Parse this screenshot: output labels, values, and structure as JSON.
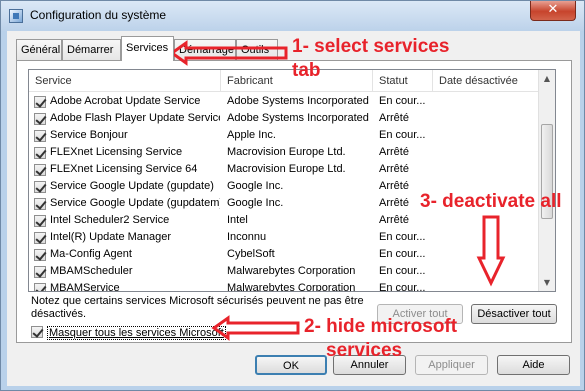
{
  "window": {
    "title": "Configuration du système",
    "close_glyph": "✕"
  },
  "tabs": [
    "Général",
    "Démarrer",
    "Services",
    "Démarrage",
    "Outils"
  ],
  "listview": {
    "columns": [
      "Service",
      "Fabricant",
      "Statut",
      "Date désactivée"
    ],
    "rows": [
      {
        "service": "Adobe Acrobat Update Service",
        "maker": "Adobe Systems Incorporated",
        "status": "En cour..."
      },
      {
        "service": "Adobe Flash Player Update Service",
        "maker": "Adobe Systems Incorporated",
        "status": "Arrêté"
      },
      {
        "service": "Service Bonjour",
        "maker": "Apple Inc.",
        "status": "En cour..."
      },
      {
        "service": "FLEXnet Licensing Service",
        "maker": "Macrovision Europe Ltd.",
        "status": "Arrêté"
      },
      {
        "service": "FLEXnet Licensing Service 64",
        "maker": "Macrovision Europe Ltd.",
        "status": "Arrêté"
      },
      {
        "service": "Service Google Update (gupdate)",
        "maker": "Google Inc.",
        "status": "Arrêté"
      },
      {
        "service": "Service Google Update (gupdatem)",
        "maker": "Google Inc.",
        "status": "Arrêté"
      },
      {
        "service": "Intel Scheduler2 Service",
        "maker": "Intel",
        "status": "Arrêté"
      },
      {
        "service": "Intel(R) Update Manager",
        "maker": "Inconnu",
        "status": "En cour..."
      },
      {
        "service": "Ma-Config Agent",
        "maker": "CybelSoft",
        "status": "En cour..."
      },
      {
        "service": "MBAMScheduler",
        "maker": "Malwarebytes Corporation",
        "status": "En cour..."
      },
      {
        "service": "MBAMService",
        "maker": "Malwarebytes Corporation",
        "status": "En cour..."
      }
    ],
    "scroll_up_glyph": "▲",
    "scroll_down_glyph": "▼"
  },
  "note": "Notez que certains services Microsoft sécurisés peuvent ne pas être désactivés.",
  "buttons": {
    "enable_all": "Activer tout",
    "disable_all": "Désactiver tout",
    "ok": "OK",
    "cancel": "Annuler",
    "apply": "Appliquer",
    "help": "Aide"
  },
  "hide_microsoft": "Masquer tous les services Microsoft",
  "annotations": {
    "step1_a": "1- select services",
    "step1_b": "tab",
    "step2_a": "2- hide microsoft",
    "step2_b": "services",
    "step3": "3- deactivate all"
  },
  "colors": {
    "annotation": "#e8232b",
    "window_border": "#b9d1ea",
    "close": "#c7442c"
  },
  "icons": [
    "app-icon",
    "close-icon",
    "arrow-icon"
  ]
}
